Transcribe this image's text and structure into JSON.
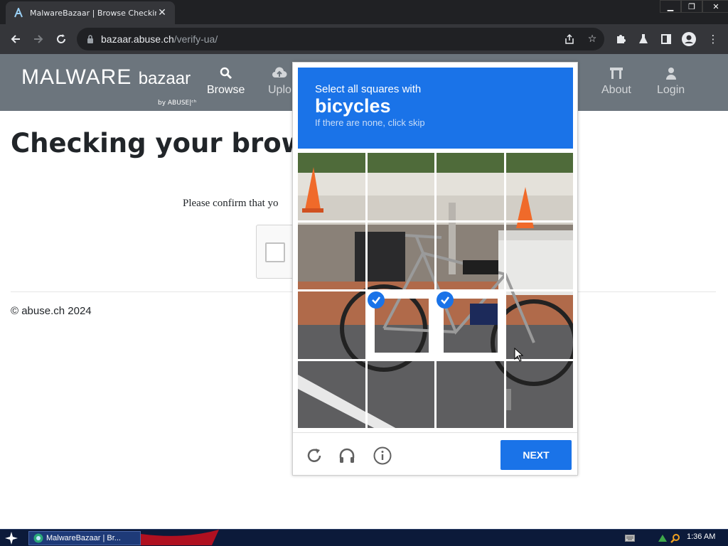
{
  "browser": {
    "tab_title": "MalwareBazaar | Browse Checking y",
    "url_host": "bazaar.abuse.ch",
    "url_path": "/verify-ua/"
  },
  "site": {
    "logo_main": "MALWARE",
    "logo_sub": "bazaar",
    "logo_by": "by ABUSE|ᶜʰ",
    "nav": {
      "browse": "Browse",
      "upload": "Uplo",
      "about": "About",
      "login": "Login"
    }
  },
  "page": {
    "title": "Checking your browser",
    "confirm_text": "Please confirm that yo",
    "footer": "© abuse.ch 2024"
  },
  "challenge": {
    "line1": "Select all squares with",
    "target": "bicycles",
    "hint": "If there are none, click skip",
    "next_label": "NEXT",
    "selected_tiles": [
      9,
      10
    ],
    "accent_color": "#1a73e8"
  },
  "taskbar": {
    "task_label": "MalwareBazaar | Br...",
    "clock": "1:36 AM"
  }
}
